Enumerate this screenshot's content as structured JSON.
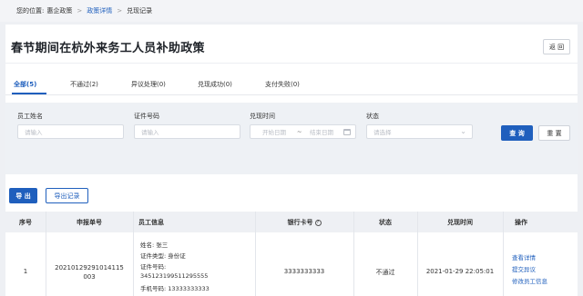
{
  "breadcrumb": {
    "prefix": "您的位置:",
    "items": [
      "惠企政策",
      "政策详情",
      "兑现记录"
    ],
    "separator": ">"
  },
  "page": {
    "title": "春节期间在杭外来务工人员补助政策",
    "back_label": "返 回"
  },
  "tabs": [
    {
      "label": "全部(5)",
      "active": true
    },
    {
      "label": "不通过(2)",
      "active": false
    },
    {
      "label": "异议处理(0)",
      "active": false
    },
    {
      "label": "兑现成功(0)",
      "active": false
    },
    {
      "label": "支付失败(0)",
      "active": false
    }
  ],
  "filters": {
    "name_label": "员工姓名",
    "name_placeholder": "请输入",
    "id_label": "证件号码",
    "id_placeholder": "请输入",
    "time_label": "兑现时间",
    "start_placeholder": "开始日期",
    "range_sep": "~",
    "end_placeholder": "结束日期",
    "status_label": "状态",
    "status_placeholder": "请选择",
    "query_label": "查 询",
    "reset_label": "重 置"
  },
  "actions": {
    "export_label": "导 出",
    "records_label": "导出记录"
  },
  "table": {
    "headers": [
      "序号",
      "申报单号",
      "员工信息",
      "银行卡号",
      "状态",
      "兑现时间",
      "操作"
    ],
    "rows": [
      {
        "index": "1",
        "apply_no_line1": "20210129291014115",
        "apply_no_line2": "003",
        "info": {
          "name": "姓名:  张三",
          "id_type": "证件类型:  身份证",
          "id_no_label": "证件号码:",
          "id_no": "345123199511295555",
          "phone": "手机号码:  13333333333"
        },
        "bank_card": "3333333333",
        "status": "不通过",
        "time": "2021-01-29 22:05:01",
        "links": [
          "查看详情",
          "提交异议",
          "修改员工信息"
        ]
      }
    ]
  },
  "colors": {
    "primary": "#1f5fbd",
    "filter_bg": "#eef1f5",
    "header_bg": "#eef0f4"
  }
}
